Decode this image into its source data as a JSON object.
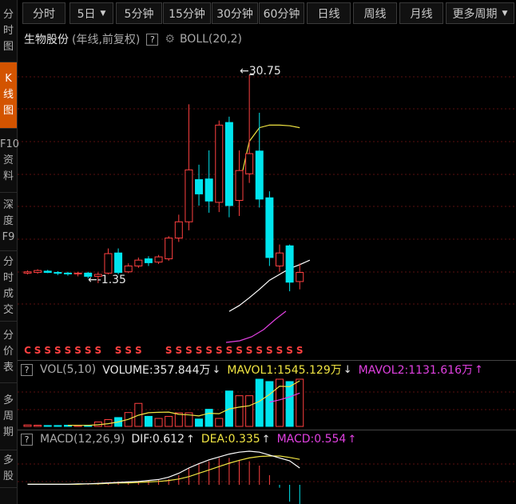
{
  "side_tabs": [
    {
      "label": [
        "分",
        "时",
        "图"
      ],
      "active": false
    },
    {
      "label": [
        "K",
        "线",
        "图"
      ],
      "active": true
    },
    {
      "label": [
        "F10",
        "资",
        "料"
      ],
      "active": false
    },
    {
      "label": [
        "深",
        "度",
        "F9"
      ],
      "active": false
    },
    {
      "label": [
        "分",
        "时",
        "成",
        "交"
      ],
      "active": false
    },
    {
      "label": [
        "分",
        "价",
        "表"
      ],
      "active": false
    },
    {
      "label": [
        "多",
        "周",
        "期"
      ],
      "active": false
    },
    {
      "label": [
        "多",
        "股"
      ],
      "active": false
    }
  ],
  "toolbar": {
    "intraday": "分时",
    "days": "5日",
    "m5": "5分钟",
    "m15": "15分钟",
    "m30": "30分钟",
    "m60": "60分钟",
    "daily": "日线",
    "weekly": "周线",
    "monthly": "月线",
    "more": "更多周期"
  },
  "header": {
    "stock_name": "生物股份",
    "mode": "(年线,前复权)",
    "help": "?",
    "indicator": "BOLL(20,2)"
  },
  "annotations": {
    "high": "30.75",
    "low": "-1.35",
    "signal_char": "S",
    "first_signal_char": "C"
  },
  "vol_panel": {
    "help": "?",
    "name": "VOL(5,10)",
    "volume": "VOLUME:357.844万",
    "mavol1": "MAVOL1:1545.129万",
    "mavol2": "MAVOL2:1131.616万",
    "volume_arrow": "↓",
    "mavol1_arrow": "↓",
    "mavol2_arrow": "↑"
  },
  "macd_panel": {
    "help": "?",
    "name": "MACD(12,26,9)",
    "dif": "DIF:0.612",
    "dea": "DEA:0.335",
    "macd": "MACD:0.554",
    "dif_arrow": "↑",
    "dea_arrow": "↑",
    "macd_arrow": "↑"
  },
  "colors": {
    "up": "#ff4040",
    "down": "#00e5ee",
    "ma_white": "#ffffff",
    "ma_yellow": "#f0e442",
    "magenta": "#e040e0",
    "active_tab": "#d35400"
  },
  "chart_data": {
    "type": "candlestick",
    "title": "",
    "price_annotations": {
      "max": 30.75,
      "min": -1.35
    },
    "candles": [
      {
        "o": 0.2,
        "c": 0.4,
        "h": 0.6,
        "l": 0.0
      },
      {
        "o": 0.3,
        "c": 0.6,
        "h": 0.8,
        "l": 0.1
      },
      {
        "o": 0.5,
        "c": 0.3,
        "h": 0.7,
        "l": 0.2
      },
      {
        "o": 0.3,
        "c": 0.2,
        "h": 0.5,
        "l": -0.1
      },
      {
        "o": 0.2,
        "c": 0.1,
        "h": 0.4,
        "l": -0.2
      },
      {
        "o": 0.1,
        "c": 0.2,
        "h": 0.4,
        "l": -0.3
      },
      {
        "o": 0.2,
        "c": -0.3,
        "h": 0.4,
        "l": -0.6
      },
      {
        "o": -0.3,
        "c": 0.0,
        "h": 0.3,
        "l": -1.35
      },
      {
        "o": 0.2,
        "c": 3.2,
        "h": 4.0,
        "l": 0.0
      },
      {
        "o": 3.3,
        "c": 0.3,
        "h": 4.0,
        "l": 0.0
      },
      {
        "o": 0.4,
        "c": 1.3,
        "h": 1.7,
        "l": 0.2
      },
      {
        "o": 1.3,
        "c": 2.2,
        "h": 2.6,
        "l": 1.0
      },
      {
        "o": 2.4,
        "c": 1.8,
        "h": 2.8,
        "l": 1.3
      },
      {
        "o": 1.9,
        "c": 2.7,
        "h": 3.0,
        "l": 1.6
      },
      {
        "o": 2.4,
        "c": 5.6,
        "h": 5.9,
        "l": 2.1
      },
      {
        "o": 5.6,
        "c": 8.1,
        "h": 9.2,
        "l": 5.0
      },
      {
        "o": 8.1,
        "c": 16.1,
        "h": 26.2,
        "l": 6.8
      },
      {
        "o": 14.6,
        "c": 12.4,
        "h": 16.9,
        "l": 10.6
      },
      {
        "o": 14.7,
        "c": 11.3,
        "h": 19.1,
        "l": 9.5
      },
      {
        "o": 11.1,
        "c": 23.0,
        "h": 23.7,
        "l": 9.6
      },
      {
        "o": 23.4,
        "c": 10.6,
        "h": 24.3,
        "l": 8.8
      },
      {
        "o": 11.4,
        "c": 16.0,
        "h": 19.1,
        "l": 9.0
      },
      {
        "o": 15.5,
        "c": 18.6,
        "h": 30.75,
        "l": 14.1
      },
      {
        "o": 19.0,
        "c": 11.6,
        "h": 24.9,
        "l": 10.3
      },
      {
        "o": 11.8,
        "c": 2.6,
        "h": 12.8,
        "l": 1.3
      },
      {
        "o": 1.3,
        "c": 3.3,
        "h": 4.6,
        "l": 0.4
      },
      {
        "o": 4.4,
        "c": -1.2,
        "h": 4.6,
        "l": -2.6
      },
      {
        "o": -1.1,
        "c": 0.3,
        "h": 1.7,
        "l": -2.3
      }
    ],
    "boll_upper_start_index": 21,
    "boll_upper": [
      13.6,
      20.5,
      22.6,
      23.0,
      23.0,
      22.9,
      22.6
    ],
    "boll_mid_start_index": 20,
    "boll_mid": [
      -5.7,
      -4.8,
      -3.6,
      -2.3,
      -0.9,
      0.0,
      0.9,
      1.5,
      2.2
    ],
    "volume": {
      "ylim": [
        0,
        1600
      ],
      "values": [
        50,
        40,
        30,
        30,
        40,
        35,
        40,
        150,
        230,
        300,
        470,
        780,
        340,
        270,
        340,
        460,
        460,
        250,
        580,
        270,
        1200,
        1040,
        1040,
        1600,
        1520,
        1600,
        1520,
        1600
      ],
      "mavol1": [
        null,
        null,
        null,
        null,
        38,
        35,
        35,
        57,
        91,
        153,
        238,
        380,
        464,
        477,
        484,
        411,
        391,
        357,
        445,
        431,
        592,
        654,
        700,
        850,
        1083,
        1362,
        1348,
        1545
      ],
      "mavol2": [
        null,
        null,
        null,
        null,
        null,
        null,
        null,
        null,
        null,
        null,
        null,
        null,
        null,
        null,
        null,
        null,
        null,
        null,
        null,
        null,
        null,
        null,
        null,
        null,
        820,
        900,
        1000,
        1131
      ]
    },
    "macd": {
      "ylim": [
        -0.5,
        0.75
      ],
      "hist": [
        0,
        0,
        0,
        0,
        0,
        0,
        0.01,
        0.02,
        0.04,
        0.05,
        0.07,
        0.08,
        0.09,
        0.1,
        0.12,
        0.2,
        0.34,
        0.44,
        0.49,
        0.56,
        0.56,
        0.52,
        0.49,
        0.4,
        0.2,
        -0.06,
        -0.35,
        -0.45
      ],
      "dif": [
        0.01,
        0.01,
        0.01,
        0.01,
        0.01,
        0.02,
        0.02,
        0.03,
        0.04,
        0.05,
        0.06,
        0.07,
        0.09,
        0.11,
        0.16,
        0.24,
        0.35,
        0.44,
        0.52,
        0.58,
        0.64,
        0.68,
        0.7,
        0.68,
        0.62,
        0.56,
        0.5,
        0.35
      ],
      "dea": [
        0.01,
        0.01,
        0.01,
        0.01,
        0.01,
        0.01,
        0.02,
        0.02,
        0.03,
        0.04,
        0.04,
        0.05,
        0.06,
        0.07,
        0.09,
        0.12,
        0.17,
        0.24,
        0.31,
        0.38,
        0.45,
        0.51,
        0.56,
        0.59,
        0.6,
        0.6,
        0.57,
        0.53
      ]
    }
  }
}
